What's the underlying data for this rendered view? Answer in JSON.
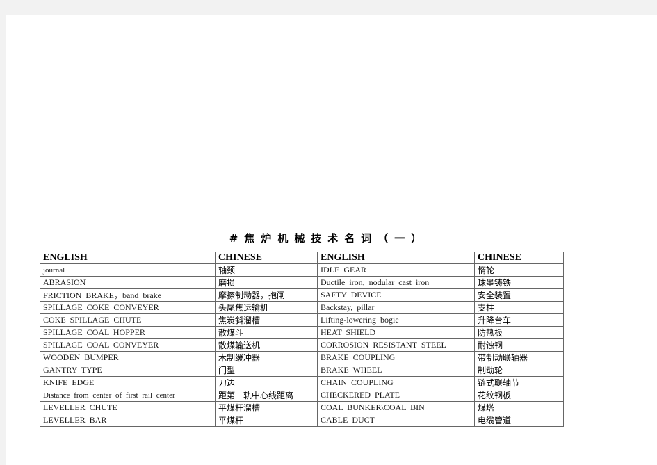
{
  "document": {
    "title": "#焦炉机械技术名词（一）"
  },
  "table": {
    "headers": [
      "ENGLISH",
      "CHINESE",
      "ENGLISH",
      "CHINESE"
    ],
    "rows": [
      {
        "en1": "journal",
        "zh1": "轴颈",
        "en2": "IDLE GEAR",
        "zh2": "惰轮"
      },
      {
        "en1": "ABRASION",
        "zh1": "磨损",
        "en2": "Ductile iron, nodular cast iron",
        "zh2": "球墨铸铁"
      },
      {
        "en1": "FRICTION BRAKE，band brake",
        "zh1": "摩擦制动器，抱闸",
        "en2": "SAFTY DEVICE",
        "zh2": "安全装置"
      },
      {
        "en1": "SPILLAGE COKE CONVEYER",
        "zh1": "头尾焦运输机",
        "en2": "Backstay, pillar",
        "zh2": "支柱"
      },
      {
        "en1": "COKE SPILLAGE CHUTE",
        "zh1": "焦炭斜溜槽",
        "en2": "Lifting-lowering bogie",
        "zh2": "升降台车"
      },
      {
        "en1": "SPILLAGE COAL HOPPER",
        "zh1": "散煤斗",
        "en2": "HEAT SHIELD",
        "zh2": "防热板"
      },
      {
        "en1": "SPILLAGE COAL CONVEYER",
        "zh1": "散煤输送机",
        "en2": "CORROSION RESISTANT STEEL",
        "zh2": "耐蚀钢"
      },
      {
        "en1": "WOODEN BUMPER",
        "zh1": "木制缓冲器",
        "en2": "BRAKE COUPLING",
        "zh2": "带制动联轴器"
      },
      {
        "en1": "GANTRY TYPE",
        "zh1": "门型",
        "en2": "BRAKE WHEEL",
        "zh2": "制动轮"
      },
      {
        "en1": "KNIFE EDGE",
        "zh1": "刀边",
        "en2": "CHAIN COUPLING",
        "zh2": "链式联轴节"
      },
      {
        "en1": "Distance from center of first rail center",
        "zh1": "距第一轨中心线距离",
        "en2": "CHECKERED PLATE",
        "zh2": "花纹钢板"
      },
      {
        "en1": "LEVELLER CHUTE",
        "zh1": "平煤杆溜槽",
        "en2": "COAL BUNKER\\COAL BIN",
        "zh2": "煤塔"
      },
      {
        "en1": "LEVELLER BAR",
        "zh1": "平煤杆",
        "en2": "CABLE DUCT",
        "zh2": "电缆管道"
      }
    ]
  }
}
